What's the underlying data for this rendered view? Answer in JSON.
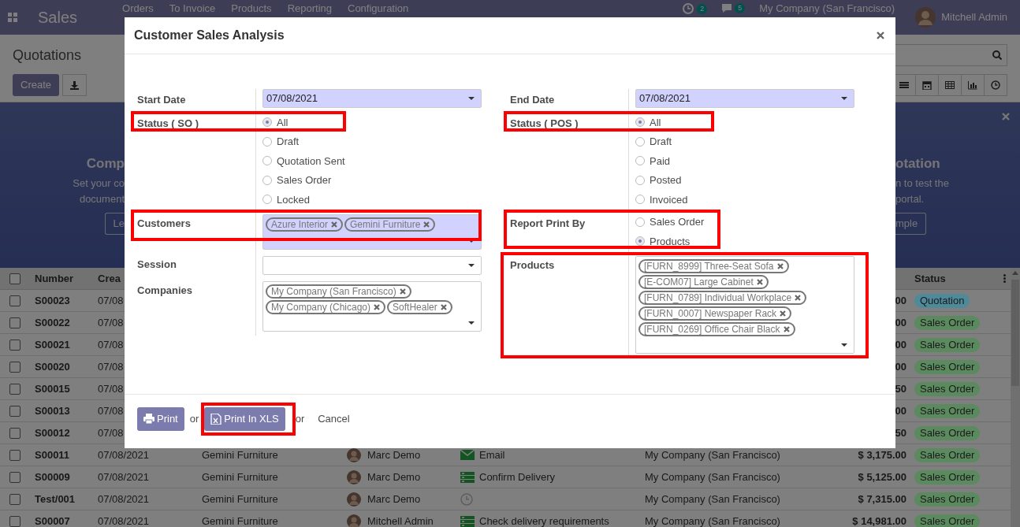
{
  "navbar": {
    "app_name": "Sales",
    "menus": [
      "Orders",
      "To Invoice",
      "Products",
      "Reporting",
      "Configuration"
    ],
    "activity_count": "2",
    "message_count": "5",
    "company": "My Company (San Francisco)",
    "user": "Mitchell Admin"
  },
  "control_panel": {
    "title": "Quotations",
    "create_label": "Create",
    "views": [
      {
        "kind": "list"
      },
      {
        "kind": "calendar"
      },
      {
        "kind": "pivot"
      },
      {
        "kind": "graph"
      },
      {
        "kind": "activity"
      }
    ]
  },
  "banner": {
    "left_title": "Comp",
    "left_lines": [
      "Set your co",
      "document"
    ],
    "left_button": "Le",
    "right_title": "otation",
    "right_lines": [
      "n to test the",
      "portal."
    ],
    "right_button": "mple"
  },
  "table": {
    "select_all": {
      "checked": false
    },
    "columns": [
      {
        "kind": "number",
        "label": "Number"
      },
      {
        "kind": "date",
        "label": "Crea"
      },
      {
        "kind": "status",
        "label": "Status"
      }
    ],
    "rows": [
      {
        "kind": "covered",
        "checked": false,
        "number": "S00023",
        "date": "07/08",
        "total": "00",
        "status": "Quotation",
        "color": "#4f8a9a"
      },
      {
        "kind": "covered",
        "checked": false,
        "number": "S00022",
        "date": "07/08",
        "total": "00",
        "status": "Sales Order",
        "color": "#5b8a5e"
      },
      {
        "kind": "covered",
        "checked": false,
        "number": "S00021",
        "date": "07/08",
        "total": "00",
        "status": "Sales Order",
        "color": "#5b8a5e"
      },
      {
        "kind": "covered",
        "checked": false,
        "number": "S00020",
        "date": "07/08",
        "total": "00",
        "status": "Sales Order",
        "color": "#5b8a5e"
      },
      {
        "kind": "covered",
        "checked": false,
        "number": "S00015",
        "date": "07/08",
        "total": "50",
        "status": "Sales Order",
        "color": "#5b8a5e"
      },
      {
        "kind": "covered",
        "checked": false,
        "number": "S00013",
        "date": "07/08",
        "total": "00",
        "status": "Sales Order",
        "color": "#5b8a5e"
      },
      {
        "kind": "covered",
        "checked": false,
        "number": "S00012",
        "date": "07/08",
        "total": "50",
        "status": "Sales Order",
        "color": "#5b8a5e"
      },
      {
        "kind": "full",
        "checked": false,
        "number": "S00011",
        "date": "07/08/2021",
        "customer": "Gemini Furniture",
        "salesperson": "Marc Demo",
        "activity": {
          "kind": "email",
          "label": "Email"
        },
        "company": "My Company (San Francisco)",
        "total": "$ 3,175.00",
        "status": "Sales Order",
        "color": "#5b8a5e"
      },
      {
        "kind": "full",
        "checked": false,
        "number": "S00009",
        "date": "07/08/2021",
        "customer": "Gemini Furniture",
        "salesperson": "Marc Demo",
        "activity": {
          "kind": "list",
          "label": "Confirm Delivery"
        },
        "company": "My Company (San Francisco)",
        "total": "$ 5,125.00",
        "status": "Sales Order",
        "color": "#5b8a5e"
      },
      {
        "kind": "full",
        "checked": false,
        "number": "Test/001",
        "date": "07/08/2021",
        "customer": "Gemini Furniture",
        "salesperson": "Marc Demo",
        "activity": {
          "kind": "clock"
        },
        "company": "My Company (San Francisco)",
        "total": "$ 7,315.00",
        "status": "Sales Order",
        "color": "#5b8a5e"
      },
      {
        "kind": "full",
        "checked": false,
        "number": "S00007",
        "date": "07/08/2021",
        "customer": "Gemini Furniture",
        "salesperson": "Mitchell Admin",
        "activity": {
          "kind": "list",
          "label": "Check delivery requirements"
        },
        "company": "My Company (San Francisco)",
        "total": "$ 14,981.00",
        "status": "Sales Order",
        "color": "#5b8a5e"
      }
    ]
  },
  "dialog": {
    "title": "Customer Sales Analysis",
    "left_fields": [
      {
        "kind": "date",
        "label": "Start Date",
        "value": "07/08/2021",
        "required": true
      },
      {
        "kind": "radio",
        "label": "Status ( SO )",
        "options": [
          {
            "label": "All",
            "selected": true
          },
          {
            "label": "Draft",
            "selected": false
          },
          {
            "label": "Quotation Sent",
            "selected": false
          },
          {
            "label": "Sales Order",
            "selected": false
          },
          {
            "label": "Locked",
            "selected": false
          }
        ]
      },
      {
        "kind": "tags",
        "label": "Customers",
        "required": true,
        "tags": [
          "Azure Interior",
          "Gemini Furniture"
        ]
      },
      {
        "kind": "select",
        "label": "Session",
        "required": false
      },
      {
        "kind": "tags",
        "label": "Companies",
        "required": false,
        "tags": [
          "My Company (San Francisco)",
          "My Company (Chicago)",
          "SoftHealer"
        ]
      }
    ],
    "right_fields": [
      {
        "kind": "date",
        "label": "End Date",
        "value": "07/08/2021",
        "required": true
      },
      {
        "kind": "radio",
        "label": "Status ( POS )",
        "options": [
          {
            "label": "All",
            "selected": true
          },
          {
            "label": "Draft",
            "selected": false
          },
          {
            "label": "Paid",
            "selected": false
          },
          {
            "label": "Posted",
            "selected": false
          },
          {
            "label": "Invoiced",
            "selected": false
          }
        ]
      },
      {
        "kind": "radio",
        "label": "Report Print By",
        "options": [
          {
            "label": "Sales Order",
            "selected": false
          },
          {
            "label": "Products",
            "selected": true
          }
        ]
      },
      {
        "kind": "tags",
        "label": "Products",
        "required": false,
        "tags": [
          "[FURN_8999] Three-Seat Sofa",
          "[E-COM07] Large Cabinet",
          "[FURN_0789] Individual Workplace",
          "[FURN_0007] Newspaper Rack",
          "[FURN_0269] Office Chair Black"
        ]
      }
    ],
    "buttons": [
      {
        "kind": "print",
        "label": "Print"
      },
      {
        "kind": "text",
        "label": "or"
      },
      {
        "kind": "xls",
        "label": "Print In XLS"
      },
      {
        "kind": "text",
        "label": "or"
      },
      {
        "kind": "link",
        "label": "Cancel"
      }
    ]
  }
}
